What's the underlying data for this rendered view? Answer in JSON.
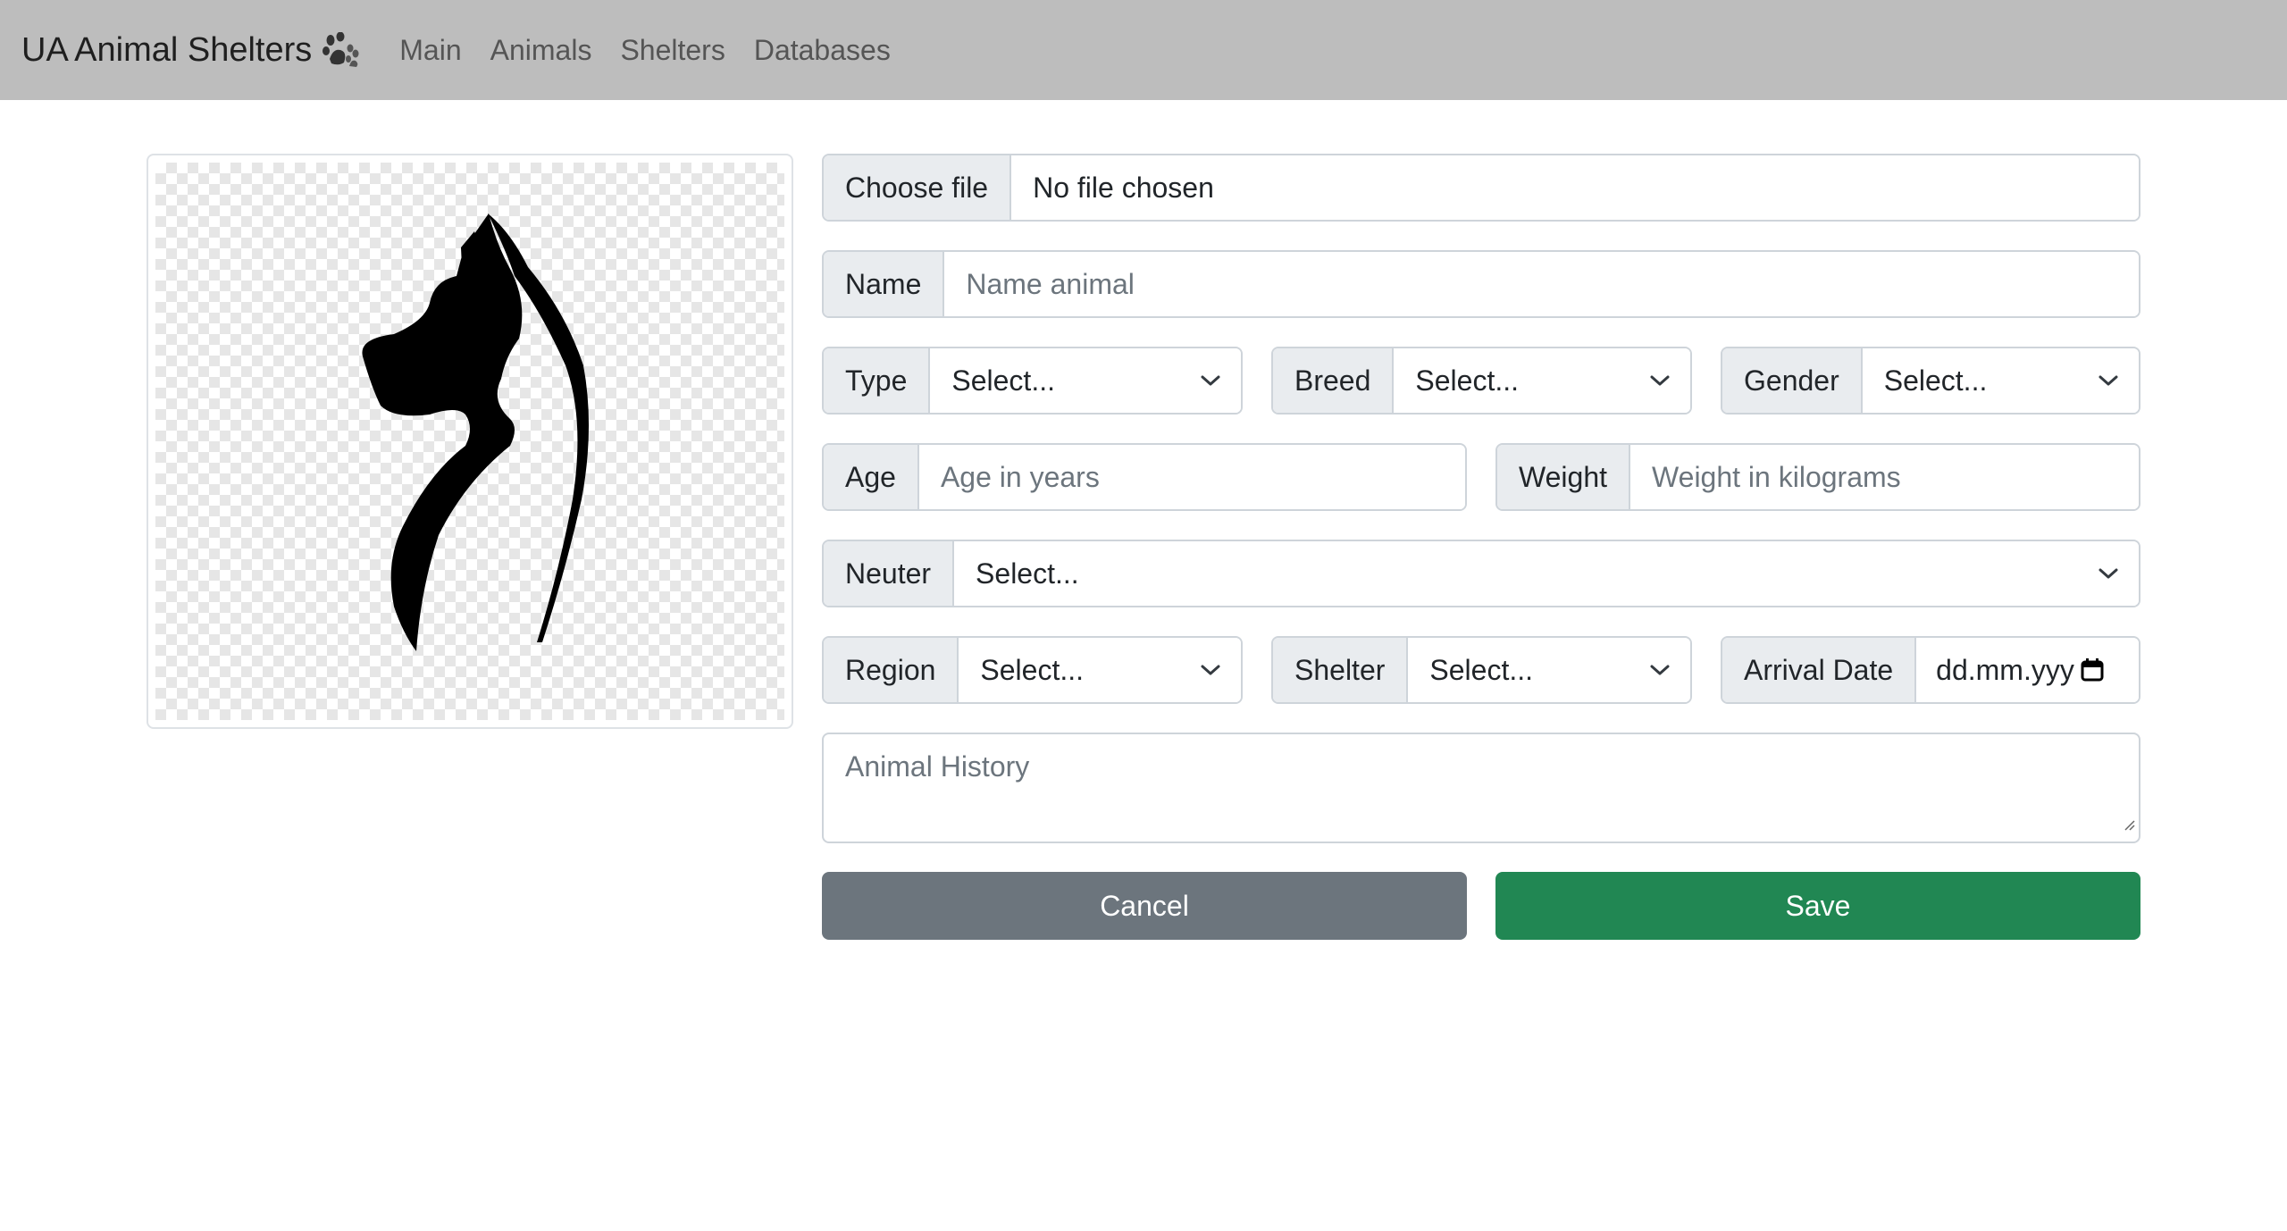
{
  "navbar": {
    "brand": "UA Animal Shelters",
    "brand_icon": "paw-icon",
    "links": [
      "Main",
      "Animals",
      "Shelters",
      "Databases"
    ]
  },
  "preview": {
    "icon": "dog-cat-silhouette"
  },
  "form": {
    "file": {
      "button": "Choose file",
      "status": "No file chosen"
    },
    "name": {
      "label": "Name",
      "placeholder": "Name animal"
    },
    "type": {
      "label": "Type",
      "value": "Select..."
    },
    "breed": {
      "label": "Breed",
      "value": "Select..."
    },
    "gender": {
      "label": "Gender",
      "value": "Select..."
    },
    "age": {
      "label": "Age",
      "placeholder": "Age in years"
    },
    "weight": {
      "label": "Weight",
      "placeholder": "Weight in kilograms"
    },
    "neuter": {
      "label": "Neuter",
      "value": "Select..."
    },
    "region": {
      "label": "Region",
      "value": "Select..."
    },
    "shelter": {
      "label": "Shelter",
      "value": "Select..."
    },
    "arrival": {
      "label": "Arrival Date",
      "value": "dd.mm.yyy"
    },
    "history": {
      "placeholder": "Animal History"
    }
  },
  "buttons": {
    "cancel": "Cancel",
    "save": "Save"
  },
  "colors": {
    "navbar": "#bdbdbd",
    "cancel": "#6c757d",
    "save": "#218753",
    "addon": "#e9ecef"
  }
}
